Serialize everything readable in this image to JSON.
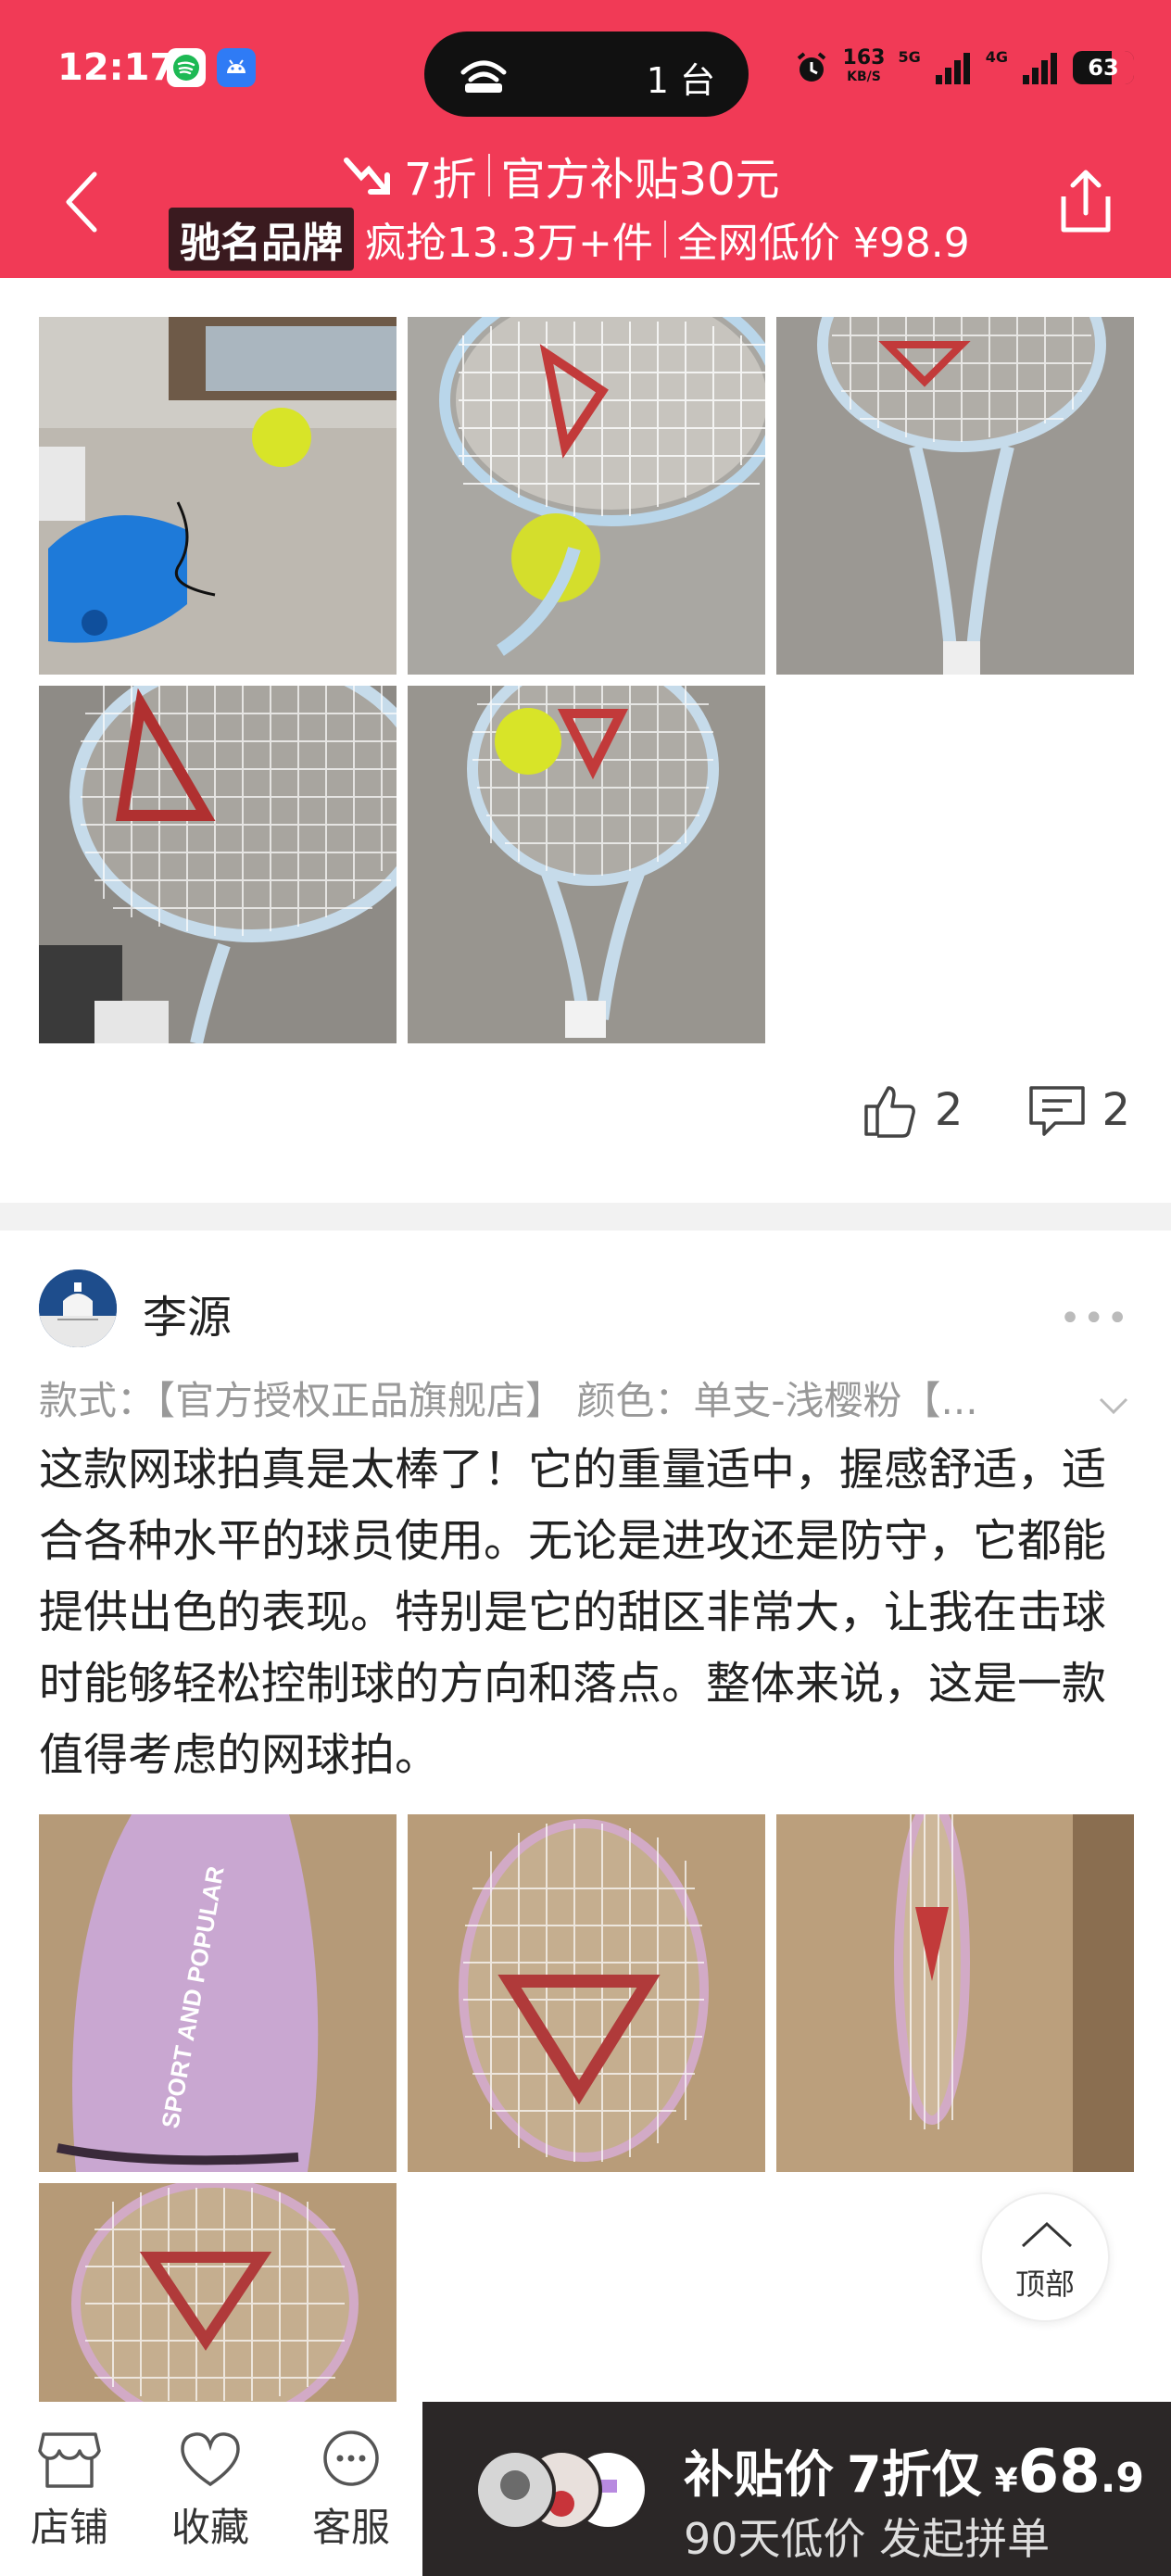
{
  "status_bar": {
    "time": "12:17",
    "pill_text": "1 台",
    "net_speed_top": "163",
    "net_speed_bottom": "KB/S",
    "net_5g": "5G",
    "net_4g": "4G",
    "battery": "63",
    "battery_level_percent": 63
  },
  "promo": {
    "discount": "7折",
    "subsidy": "官方补贴30元",
    "brand_tag": "驰名品牌",
    "sold": "疯抢13.3万+件",
    "lowest": "全网低价 ¥98.9"
  },
  "review1": {
    "likes": "2",
    "comments": "2"
  },
  "review2": {
    "user": "李源",
    "spec": "款式：【官方授权正品旗舰店】 颜色：单支-浅樱粉【...",
    "text": "这款网球拍真是太棒了！它的重量适中，握感舒适，适合各种水平的球员使用。无论是进攻还是防守，它都能提供出色的表现。特别是它的甜区非常大，让我在击球时能够轻松控制球的方向和落点。整体来说，这是一款值得考虑的网球拍。",
    "more": "•••"
  },
  "to_top": "顶部",
  "bottom_bar": {
    "shop": "店铺",
    "favorite": "收藏",
    "service": "客服",
    "buy_label": "补贴价",
    "buy_discount": "7折仅",
    "currency": "¥",
    "price_int": "68",
    "price_dec": ".9",
    "buy_line2": "90天低价 发起拼单"
  },
  "colors": {
    "brand_red": "#f13a56",
    "buy_bar": "#2b2727"
  }
}
